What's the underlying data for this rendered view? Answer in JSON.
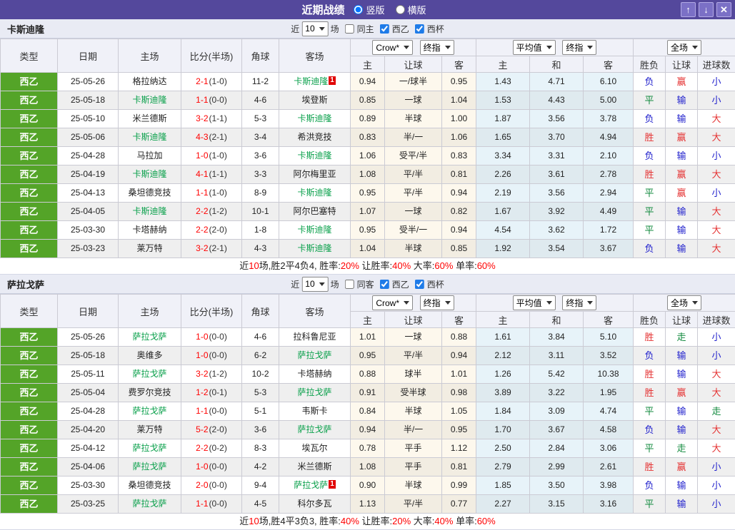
{
  "titlebar": {
    "title": "近期战绩",
    "radio_vertical": "竖版",
    "radio_vertical_checked": true,
    "radio_horizontal": "横版",
    "radio_horizontal_checked": false,
    "up_icon": "↑",
    "down_icon": "↓",
    "close_icon": "✕"
  },
  "colors": {
    "titlebar_purple": "#54489C",
    "league_green": "#54A428",
    "self_team_green": "#0AA04B",
    "score_red": "#FF0000",
    "win_red": "#E53333",
    "lose_blue": "#2222CD",
    "draw_green": "#128A3E"
  },
  "filter_labels": {
    "near": "近",
    "games": "场"
  },
  "selects": {
    "crow": "Crow*",
    "final1": "终指",
    "avg": "平均值",
    "final2": "终指",
    "full": "全场"
  },
  "columns": {
    "type": "类型",
    "date": "日期",
    "home": "主场",
    "score": "比分(半场)",
    "corner": "角球",
    "away": "客场",
    "home2": "主",
    "handicap": "让球",
    "away2": "客",
    "avg_home": "主",
    "avg_draw": "和",
    "avg_away": "客",
    "wdl": "胜负",
    "handicap2": "让球",
    "goals": "进球数"
  },
  "sections": [
    {
      "team": "卡斯迪隆",
      "filter": {
        "count": "10",
        "same": "同主",
        "same_checked": false,
        "league": "西乙",
        "league_checked": true,
        "cup": "西杯",
        "cup_checked": true
      },
      "rows": [
        {
          "league": "西乙",
          "date": "25-05-26",
          "home": "格拉纳达",
          "home_self": false,
          "score": "2-1",
          "half": "(1-0)",
          "corner": "11-2",
          "away": "卡斯迪隆",
          "away_self": true,
          "away_card": "1",
          "odds": [
            "0.94",
            "一/球半",
            "0.95",
            "1.43",
            "4.71",
            "6.10"
          ],
          "results": [
            {
              "t": "负",
              "c": "blue"
            },
            {
              "t": "赢",
              "c": "red"
            },
            {
              "t": "小",
              "c": "blue"
            }
          ]
        },
        {
          "league": "西乙",
          "date": "25-05-18",
          "home": "卡斯迪隆",
          "home_self": true,
          "score": "1-1",
          "half": "(0-0)",
          "corner": "4-6",
          "away": "埃登斯",
          "away_self": false,
          "odds": [
            "0.85",
            "一球",
            "1.04",
            "1.53",
            "4.43",
            "5.00"
          ],
          "results": [
            {
              "t": "平",
              "c": "green"
            },
            {
              "t": "输",
              "c": "blue"
            },
            {
              "t": "小",
              "c": "blue"
            }
          ]
        },
        {
          "league": "西乙",
          "date": "25-05-10",
          "home": "米兰德斯",
          "home_self": false,
          "score": "3-2",
          "half": "(1-1)",
          "corner": "5-3",
          "away": "卡斯迪隆",
          "away_self": true,
          "odds": [
            "0.89",
            "半球",
            "1.00",
            "1.87",
            "3.56",
            "3.78"
          ],
          "results": [
            {
              "t": "负",
              "c": "blue"
            },
            {
              "t": "输",
              "c": "blue"
            },
            {
              "t": "大",
              "c": "red"
            }
          ]
        },
        {
          "league": "西乙",
          "date": "25-05-06",
          "home": "卡斯迪隆",
          "home_self": true,
          "score": "4-3",
          "half": "(2-1)",
          "corner": "3-4",
          "away": "希洪竞技",
          "away_self": false,
          "odds": [
            "0.83",
            "半/一",
            "1.06",
            "1.65",
            "3.70",
            "4.94"
          ],
          "results": [
            {
              "t": "胜",
              "c": "red"
            },
            {
              "t": "赢",
              "c": "red"
            },
            {
              "t": "大",
              "c": "red"
            }
          ]
        },
        {
          "league": "西乙",
          "date": "25-04-28",
          "home": "马拉加",
          "home_self": false,
          "score": "1-0",
          "half": "(1-0)",
          "corner": "3-6",
          "away": "卡斯迪隆",
          "away_self": true,
          "odds": [
            "1.06",
            "受平/半",
            "0.83",
            "3.34",
            "3.31",
            "2.10"
          ],
          "results": [
            {
              "t": "负",
              "c": "blue"
            },
            {
              "t": "输",
              "c": "blue"
            },
            {
              "t": "小",
              "c": "blue"
            }
          ]
        },
        {
          "league": "西乙",
          "date": "25-04-19",
          "home": "卡斯迪隆",
          "home_self": true,
          "score": "4-1",
          "half": "(1-1)",
          "corner": "3-3",
          "away": "阿尔梅里亚",
          "away_self": false,
          "odds": [
            "1.08",
            "平/半",
            "0.81",
            "2.26",
            "3.61",
            "2.78"
          ],
          "results": [
            {
              "t": "胜",
              "c": "red"
            },
            {
              "t": "赢",
              "c": "red"
            },
            {
              "t": "大",
              "c": "red"
            }
          ]
        },
        {
          "league": "西乙",
          "date": "25-04-13",
          "home": "桑坦德竞技",
          "home_self": false,
          "score": "1-1",
          "half": "(1-0)",
          "corner": "8-9",
          "away": "卡斯迪隆",
          "away_self": true,
          "odds": [
            "0.95",
            "平/半",
            "0.94",
            "2.19",
            "3.56",
            "2.94"
          ],
          "results": [
            {
              "t": "平",
              "c": "green"
            },
            {
              "t": "赢",
              "c": "red"
            },
            {
              "t": "小",
              "c": "blue"
            }
          ]
        },
        {
          "league": "西乙",
          "date": "25-04-05",
          "home": "卡斯迪隆",
          "home_self": true,
          "score": "2-2",
          "half": "(1-2)",
          "corner": "10-1",
          "away": "阿尔巴塞特",
          "away_self": false,
          "odds": [
            "1.07",
            "一球",
            "0.82",
            "1.67",
            "3.92",
            "4.49"
          ],
          "results": [
            {
              "t": "平",
              "c": "green"
            },
            {
              "t": "输",
              "c": "blue"
            },
            {
              "t": "大",
              "c": "red"
            }
          ]
        },
        {
          "league": "西乙",
          "date": "25-03-30",
          "home": "卡塔赫纳",
          "home_self": false,
          "score": "2-2",
          "half": "(2-0)",
          "corner": "1-8",
          "away": "卡斯迪隆",
          "away_self": true,
          "odds": [
            "0.95",
            "受半/一",
            "0.94",
            "4.54",
            "3.62",
            "1.72"
          ],
          "results": [
            {
              "t": "平",
              "c": "green"
            },
            {
              "t": "输",
              "c": "blue"
            },
            {
              "t": "大",
              "c": "red"
            }
          ]
        },
        {
          "league": "西乙",
          "date": "25-03-23",
          "home": "莱万特",
          "home_self": false,
          "score": "3-2",
          "half": "(2-1)",
          "corner": "4-3",
          "away": "卡斯迪隆",
          "away_self": true,
          "odds": [
            "1.04",
            "半球",
            "0.85",
            "1.92",
            "3.54",
            "3.67"
          ],
          "results": [
            {
              "t": "负",
              "c": "blue"
            },
            {
              "t": "输",
              "c": "blue"
            },
            {
              "t": "大",
              "c": "red"
            }
          ]
        }
      ],
      "summary": [
        {
          "t": "近"
        },
        {
          "t": "10",
          "red": 1
        },
        {
          "t": "场,胜2平4负4, 胜率:"
        },
        {
          "t": "20%",
          "red": 1
        },
        {
          "t": " 让胜率:"
        },
        {
          "t": "40%",
          "red": 1
        },
        {
          "t": " 大率:"
        },
        {
          "t": "60%",
          "red": 1
        },
        {
          "t": " 单率:"
        },
        {
          "t": "60%",
          "red": 1
        }
      ]
    },
    {
      "team": "萨拉戈萨",
      "filter": {
        "count": "10",
        "same": "同客",
        "same_checked": false,
        "league": "西乙",
        "league_checked": true,
        "cup": "西杯",
        "cup_checked": true
      },
      "rows": [
        {
          "league": "西乙",
          "date": "25-05-26",
          "home": "萨拉戈萨",
          "home_self": true,
          "score": "1-0",
          "half": "(0-0)",
          "corner": "4-6",
          "away": "拉科鲁尼亚",
          "away_self": false,
          "odds": [
            "1.01",
            "一球",
            "0.88",
            "1.61",
            "3.84",
            "5.10"
          ],
          "results": [
            {
              "t": "胜",
              "c": "red"
            },
            {
              "t": "走",
              "c": "green"
            },
            {
              "t": "小",
              "c": "blue"
            }
          ]
        },
        {
          "league": "西乙",
          "date": "25-05-18",
          "home": "奥维多",
          "home_self": false,
          "score": "1-0",
          "half": "(0-0)",
          "corner": "6-2",
          "away": "萨拉戈萨",
          "away_self": true,
          "odds": [
            "0.95",
            "平/半",
            "0.94",
            "2.12",
            "3.11",
            "3.52"
          ],
          "results": [
            {
              "t": "负",
              "c": "blue"
            },
            {
              "t": "输",
              "c": "blue"
            },
            {
              "t": "小",
              "c": "blue"
            }
          ]
        },
        {
          "league": "西乙",
          "date": "25-05-11",
          "home": "萨拉戈萨",
          "home_self": true,
          "score": "3-2",
          "half": "(1-2)",
          "corner": "10-2",
          "away": "卡塔赫纳",
          "away_self": false,
          "odds": [
            "0.88",
            "球半",
            "1.01",
            "1.26",
            "5.42",
            "10.38"
          ],
          "results": [
            {
              "t": "胜",
              "c": "red"
            },
            {
              "t": "输",
              "c": "blue"
            },
            {
              "t": "大",
              "c": "red"
            }
          ]
        },
        {
          "league": "西乙",
          "date": "25-05-04",
          "home": "费罗尔竞技",
          "home_self": false,
          "score": "1-2",
          "half": "(0-1)",
          "corner": "5-3",
          "away": "萨拉戈萨",
          "away_self": true,
          "odds": [
            "0.91",
            "受半球",
            "0.98",
            "3.89",
            "3.22",
            "1.95"
          ],
          "results": [
            {
              "t": "胜",
              "c": "red"
            },
            {
              "t": "赢",
              "c": "red"
            },
            {
              "t": "大",
              "c": "red"
            }
          ]
        },
        {
          "league": "西乙",
          "date": "25-04-28",
          "home": "萨拉戈萨",
          "home_self": true,
          "score": "1-1",
          "half": "(0-0)",
          "corner": "5-1",
          "away": "韦斯卡",
          "away_self": false,
          "odds": [
            "0.84",
            "半球",
            "1.05",
            "1.84",
            "3.09",
            "4.74"
          ],
          "results": [
            {
              "t": "平",
              "c": "green"
            },
            {
              "t": "输",
              "c": "blue"
            },
            {
              "t": "走",
              "c": "green"
            }
          ]
        },
        {
          "league": "西乙",
          "date": "25-04-20",
          "home": "莱万特",
          "home_self": false,
          "score": "5-2",
          "half": "(2-0)",
          "corner": "3-6",
          "away": "萨拉戈萨",
          "away_self": true,
          "odds": [
            "0.94",
            "半/一",
            "0.95",
            "1.70",
            "3.67",
            "4.58"
          ],
          "results": [
            {
              "t": "负",
              "c": "blue"
            },
            {
              "t": "输",
              "c": "blue"
            },
            {
              "t": "大",
              "c": "red"
            }
          ]
        },
        {
          "league": "西乙",
          "date": "25-04-12",
          "home": "萨拉戈萨",
          "home_self": true,
          "score": "2-2",
          "half": "(0-2)",
          "corner": "8-3",
          "away": "埃瓦尔",
          "away_self": false,
          "odds": [
            "0.78",
            "平手",
            "1.12",
            "2.50",
            "2.84",
            "3.06"
          ],
          "results": [
            {
              "t": "平",
              "c": "green"
            },
            {
              "t": "走",
              "c": "green"
            },
            {
              "t": "大",
              "c": "red"
            }
          ]
        },
        {
          "league": "西乙",
          "date": "25-04-06",
          "home": "萨拉戈萨",
          "home_self": true,
          "score": "1-0",
          "half": "(0-0)",
          "corner": "4-2",
          "away": "米兰德斯",
          "away_self": false,
          "odds": [
            "1.08",
            "平手",
            "0.81",
            "2.79",
            "2.99",
            "2.61"
          ],
          "results": [
            {
              "t": "胜",
              "c": "red"
            },
            {
              "t": "赢",
              "c": "red"
            },
            {
              "t": "小",
              "c": "blue"
            }
          ]
        },
        {
          "league": "西乙",
          "date": "25-03-30",
          "home": "桑坦德竞技",
          "home_self": false,
          "score": "2-0",
          "half": "(0-0)",
          "corner": "9-4",
          "away": "萨拉戈萨",
          "away_self": true,
          "away_card": "1",
          "odds": [
            "0.90",
            "半球",
            "0.99",
            "1.85",
            "3.50",
            "3.98"
          ],
          "results": [
            {
              "t": "负",
              "c": "blue"
            },
            {
              "t": "输",
              "c": "blue"
            },
            {
              "t": "小",
              "c": "blue"
            }
          ]
        },
        {
          "league": "西乙",
          "date": "25-03-25",
          "home": "萨拉戈萨",
          "home_self": true,
          "score": "1-1",
          "half": "(0-0)",
          "corner": "4-5",
          "away": "科尔多瓦",
          "away_self": false,
          "odds": [
            "1.13",
            "平/半",
            "0.77",
            "2.27",
            "3.15",
            "3.16"
          ],
          "results": [
            {
              "t": "平",
              "c": "green"
            },
            {
              "t": "输",
              "c": "blue"
            },
            {
              "t": "小",
              "c": "blue"
            }
          ]
        }
      ],
      "summary": [
        {
          "t": "近"
        },
        {
          "t": "10",
          "red": 1
        },
        {
          "t": "场,胜4平3负3, 胜率:"
        },
        {
          "t": "40%",
          "red": 1
        },
        {
          "t": " 让胜率:"
        },
        {
          "t": "20%",
          "red": 1
        },
        {
          "t": " 大率:"
        },
        {
          "t": "40%",
          "red": 1
        },
        {
          "t": " 单率:"
        },
        {
          "t": "60%",
          "red": 1
        }
      ]
    }
  ]
}
